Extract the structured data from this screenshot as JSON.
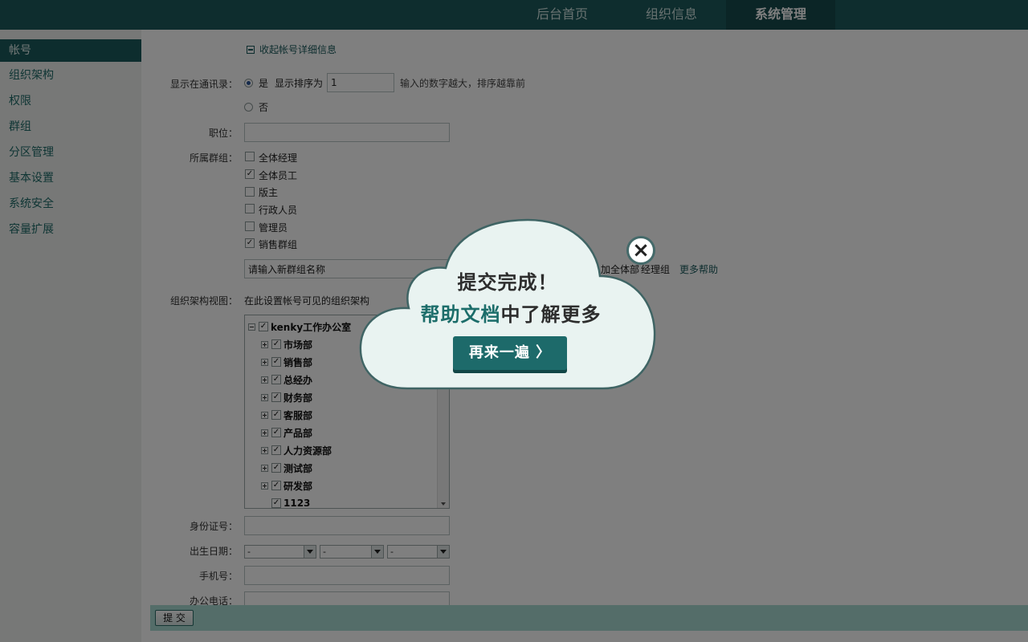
{
  "topnav": {
    "tabs": [
      {
        "label": "后台首页"
      },
      {
        "label": "组织信息"
      },
      {
        "label": "系统管理"
      }
    ]
  },
  "sidebar": {
    "items": [
      {
        "label": "帐号"
      },
      {
        "label": "组织架构"
      },
      {
        "label": "权限"
      },
      {
        "label": "群组"
      },
      {
        "label": "分区管理"
      },
      {
        "label": "基本设置"
      },
      {
        "label": "系统安全"
      },
      {
        "label": "容量扩展"
      }
    ]
  },
  "form": {
    "collapse_label": "收起帐号详细信息",
    "show_in_contacts": {
      "label": "显示在通讯录：",
      "yes": "是",
      "order_label": "显示排序为",
      "order_value": "1",
      "hint": "输入的数字越大，排序越靠前",
      "no": "否"
    },
    "position": {
      "label": "职位：",
      "value": ""
    },
    "groups": {
      "label": "所属群组：",
      "items": [
        {
          "name": "全体经理",
          "checked": false
        },
        {
          "name": "全体员工",
          "checked": true
        },
        {
          "name": "版主",
          "checked": false
        },
        {
          "name": "行政人员",
          "checked": false
        },
        {
          "name": "管理员",
          "checked": false
        },
        {
          "name": "销售群组",
          "checked": true
        }
      ],
      "new_group_placeholder": "请输入新群组名称",
      "partial_text_1": "加全体部",
      "partial_text_2": "经理组",
      "more_help": "更多帮助"
    },
    "org_view": {
      "label": "组织架构视图：",
      "hint": "在此设置帐号可见的组织架构",
      "tree": [
        {
          "name": "kenky工作办公室",
          "level": 0,
          "expander": "minus",
          "checked": true
        },
        {
          "name": "市场部",
          "level": 1,
          "expander": "plus",
          "checked": true
        },
        {
          "name": "销售部",
          "level": 1,
          "expander": "plus",
          "checked": true
        },
        {
          "name": "总经办",
          "level": 1,
          "expander": "plus",
          "checked": true
        },
        {
          "name": "财务部",
          "level": 1,
          "expander": "plus",
          "checked": true
        },
        {
          "name": "客服部",
          "level": 1,
          "expander": "plus",
          "checked": true
        },
        {
          "name": "产品部",
          "level": 1,
          "expander": "plus",
          "checked": true
        },
        {
          "name": "人力资源部",
          "level": 1,
          "expander": "plus",
          "checked": true
        },
        {
          "name": "测试部",
          "level": 1,
          "expander": "plus",
          "checked": true
        },
        {
          "name": "研发部",
          "level": 1,
          "expander": "plus",
          "checked": true
        },
        {
          "name": "1123",
          "level": 1,
          "expander": "none",
          "checked": true
        }
      ]
    },
    "id_card": {
      "label": "身份证号：",
      "value": ""
    },
    "birthday": {
      "label": "出生日期：",
      "year": "-",
      "month": "-",
      "day": "-"
    },
    "mobile": {
      "label": "手机号：",
      "value": ""
    },
    "office_phone": {
      "label": "办公电话：",
      "value": ""
    },
    "submit_label": "提 交"
  },
  "popup": {
    "title": "提交完成！",
    "sub_highlight": "帮助文档",
    "sub_rest": "中了解更多",
    "button_label": "再来一遍 〉",
    "close_symbol": "×"
  },
  "colors": {
    "brand": "#1c5a5c",
    "accent": "#1d6a6a",
    "cloud_fill": "#e9f3f1"
  }
}
